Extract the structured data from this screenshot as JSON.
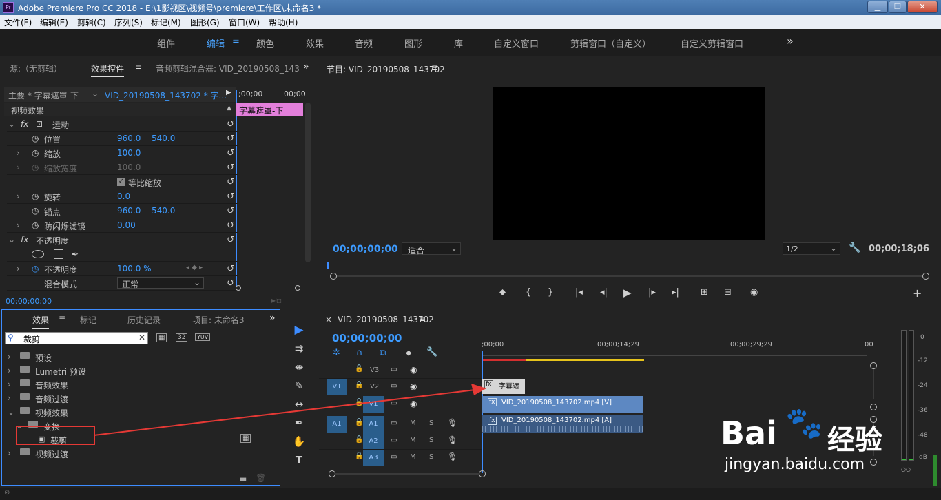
{
  "window": {
    "title": "Adobe Premiere Pro CC 2018 - E:\\1影视区\\视频号\\premiere\\工作区\\未命名3 *",
    "logo_text": "Pr",
    "minimize": "▁",
    "maximize": "❐",
    "close": "✕"
  },
  "menu": [
    "文件(F)",
    "编辑(E)",
    "剪辑(C)",
    "序列(S)",
    "标记(M)",
    "图形(G)",
    "窗口(W)",
    "帮助(H)"
  ],
  "workspaces": {
    "items": [
      "组件",
      "编辑",
      "颜色",
      "效果",
      "音频",
      "图形",
      "库",
      "自定义窗口",
      "剪辑窗口（自定义）",
      "自定义剪辑窗口"
    ],
    "active": "编辑",
    "more": "»"
  },
  "source_panel": {
    "tabs": [
      "源:（无剪辑）",
      "效果控件",
      "音频剪辑混合器: VID_20190508_143",
      "»"
    ],
    "header_left": "主要 * 字幕遮罩-下",
    "header_clip": "VID_20190508_143702 * 字...",
    "mini_tc1": ";00;00",
    "mini_tc2": "00;00",
    "clip_label": "字幕遮罩-下",
    "section": "视频效果",
    "rows": [
      {
        "label": "运动",
        "v1": "",
        "v2": ""
      },
      {
        "label": "位置",
        "v1": "960.0",
        "v2": "540.0"
      },
      {
        "label": "缩放",
        "v1": "100.0",
        "v2": ""
      },
      {
        "label": "缩放宽度",
        "v1": "100.0",
        "v2": ""
      },
      {
        "label": "等比缩放",
        "v1": "",
        "v2": ""
      },
      {
        "label": "旋转",
        "v1": "0.0",
        "v2": ""
      },
      {
        "label": "锚点",
        "v1": "960.0",
        "v2": "540.0"
      },
      {
        "label": "防闪烁滤镜",
        "v1": "0.00",
        "v2": ""
      },
      {
        "label": "不透明度",
        "v1": "",
        "v2": ""
      },
      {
        "label": "",
        "v1": "",
        "v2": ""
      },
      {
        "label": "不透明度",
        "v1": "100.0 %",
        "v2": ""
      },
      {
        "label": "混合模式",
        "v1": "正常",
        "v2": ""
      }
    ],
    "fx": "fx",
    "timecode": "00;00;00;00"
  },
  "program_panel": {
    "title": "节目: VID_20190508_143702",
    "timecode": "00;00;00;00",
    "fit": "适合",
    "resolution": "1/2",
    "duration": "00;00;18;06",
    "playhead_progress": 0.0,
    "controls": [
      "⬥",
      "{",
      "}",
      "|◂",
      "◂|",
      "▶",
      "|▸",
      "▸|",
      "⊞",
      "⊟",
      "◉"
    ],
    "add": "+"
  },
  "effects_panel": {
    "tabs": [
      "效果",
      "标记",
      "历史记录",
      "项目: 未命名3",
      "»"
    ],
    "search_value": "裁剪",
    "items": [
      {
        "label": "预设",
        "level": 0
      },
      {
        "label": "Lumetri 预设",
        "level": 0
      },
      {
        "label": "音频效果",
        "level": 0
      },
      {
        "label": "音频过渡",
        "level": 0
      },
      {
        "label": "视频效果",
        "level": 0
      },
      {
        "label": "变换",
        "level": 1
      },
      {
        "label": "裁剪",
        "level": 2
      },
      {
        "label": "视频过渡",
        "level": 0
      }
    ]
  },
  "tools": [
    "▶",
    "⇉",
    "⇹",
    "✎",
    "↔",
    "✒",
    "✋",
    "T"
  ],
  "timeline": {
    "title": "VID_20190508_143702",
    "close": "×",
    "timecode": "00;00;00;00",
    "ruler": [
      ";00;00",
      "00;00;14;29",
      "00;00;29;29",
      "00"
    ],
    "video_tracks": [
      "V3",
      "V2",
      "V1"
    ],
    "audio_tracks": [
      "A1",
      "A2",
      "A3"
    ],
    "source_patch_v": "V1",
    "source_patch_a": "A1",
    "clips": {
      "title_clip": "字幕遮",
      "video_clip": "VID_20190508_143702.mp4 [V]",
      "audio_clip": "VID_20190508_143702.mp4 [A]"
    },
    "m": "M",
    "s": "S"
  },
  "meter": {
    "labels": [
      "0",
      "-12",
      "-24",
      "-36",
      "-48",
      "dB"
    ]
  },
  "watermark": {
    "brand": "Bai",
    "brand2": "经验",
    "url": "jingyan.baidu.com"
  }
}
